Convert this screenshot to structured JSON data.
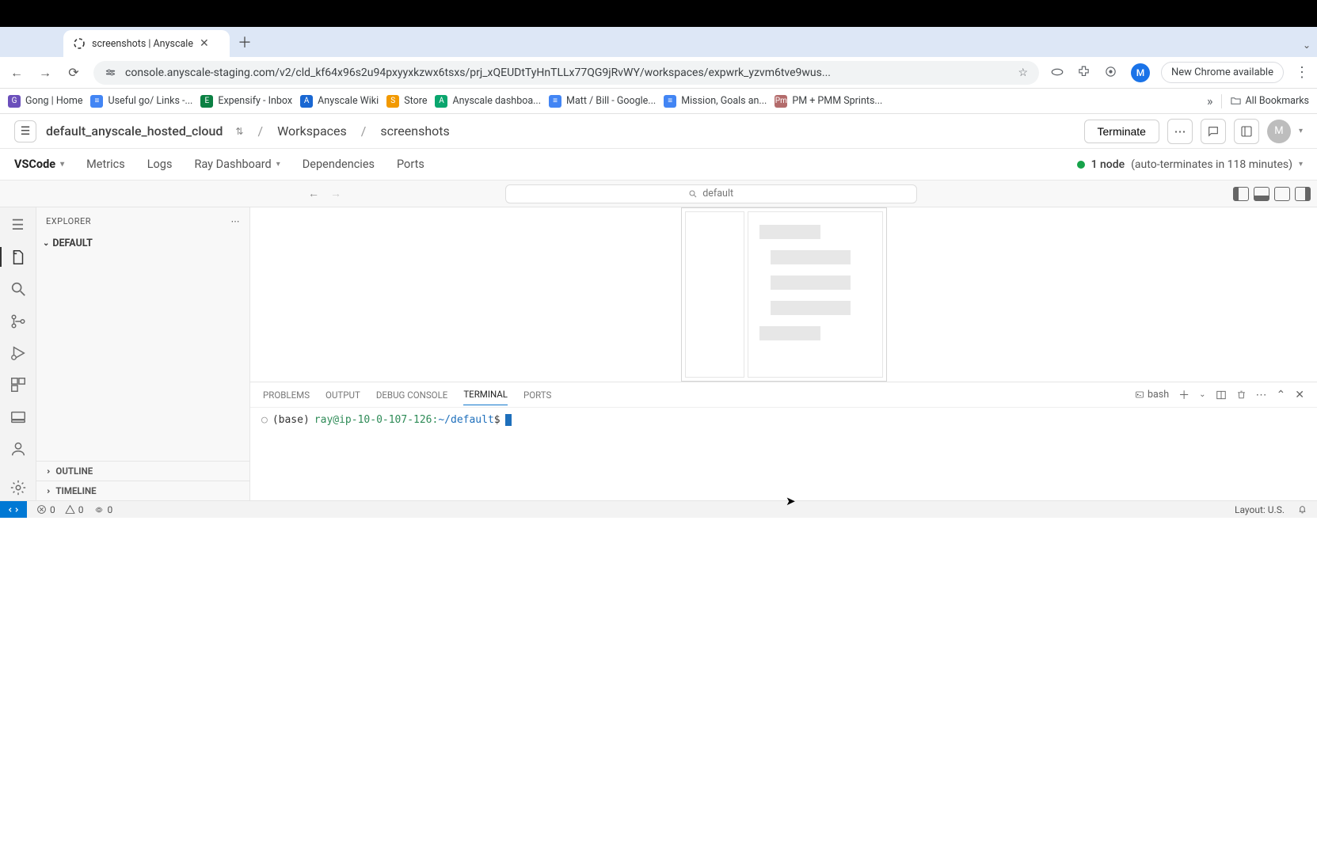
{
  "browser": {
    "tab_title": "screenshots | Anyscale",
    "url": "console.anyscale-staging.com/v2/cld_kf64x96s2u94pxyyxkzwx6tsxs/prj_xQEUDtTyHnTLLx77QG9jRvWY/workspaces/expwrk_yzvm6tve9wus...",
    "new_chrome": "New Chrome available",
    "avatar_letter": "M",
    "bookmarks": [
      "Gong | Home",
      "Useful go/ Links -...",
      "Expensify - Inbox",
      "Anyscale Wiki",
      "Store",
      "Anyscale dashboa...",
      "Matt / Bill - Google...",
      "Mission, Goals an...",
      "PM + PMM Sprints..."
    ],
    "all_bookmarks": "All Bookmarks"
  },
  "anyscale": {
    "cloud": "default_anyscale_hosted_cloud",
    "crumb1": "Workspaces",
    "crumb2": "screenshots",
    "terminate": "Terminate",
    "avatar_letter": "M",
    "tabs": [
      "VSCode",
      "Metrics",
      "Logs",
      "Ray Dashboard",
      "Dependencies",
      "Ports"
    ],
    "node_status": "1 node",
    "auto_term": "(auto-terminates in 118 minutes)"
  },
  "vscode": {
    "search_label": "default",
    "explorer_title": "EXPLORER",
    "folder_name": "DEFAULT",
    "outline": "OUTLINE",
    "timeline": "TIMELINE",
    "term_tabs": [
      "PROBLEMS",
      "OUTPUT",
      "DEBUG CONSOLE",
      "TERMINAL",
      "PORTS"
    ],
    "bash_label": "bash",
    "prompt_base": "(base)",
    "prompt_userhost": "ray@ip-10-0-107-126:",
    "prompt_path": "~/default",
    "prompt_dollar": "$",
    "status": {
      "errors": "0",
      "warnings": "0",
      "ports": "0",
      "layout": "Layout: U.S."
    }
  }
}
